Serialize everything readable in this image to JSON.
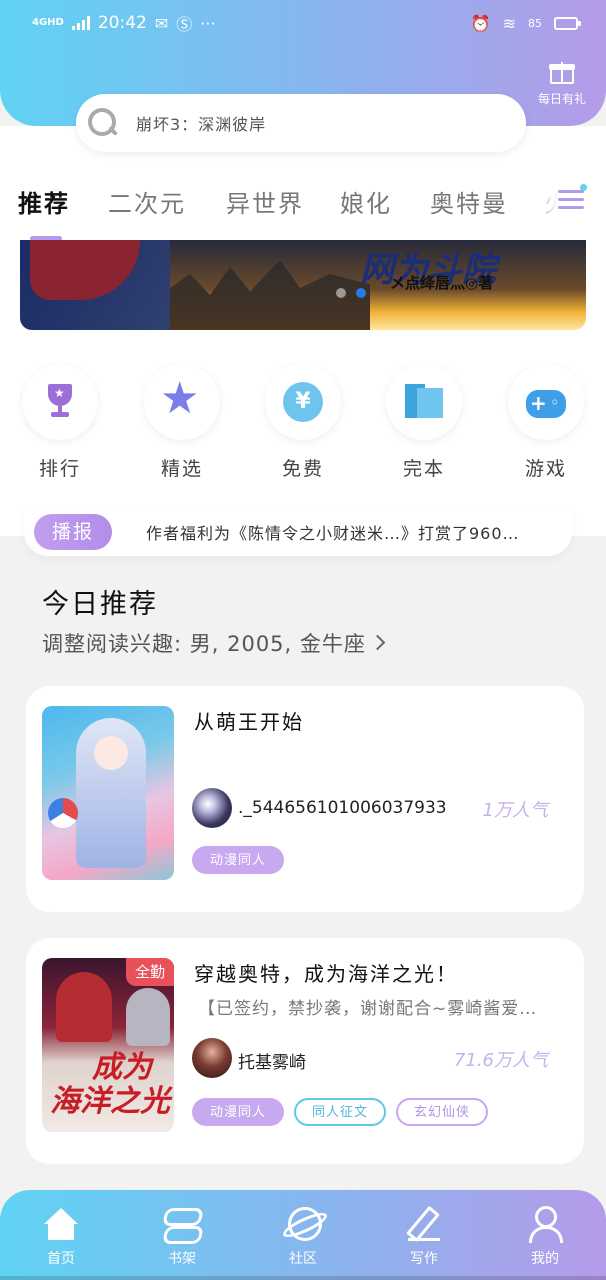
{
  "status_bar": {
    "network": "4GHD",
    "time": "20:42",
    "icons": [
      "wechat-icon",
      "s-app-icon",
      "more-dots-icon",
      "alarm-icon",
      "wifi-icon",
      "battery-icon"
    ],
    "more": "···",
    "battery_label": "85"
  },
  "search": {
    "placeholder": "崩坏3：深渊彼岸"
  },
  "daily_gift": {
    "label": "每日有礼"
  },
  "tabs": [
    {
      "label": "推荐",
      "active": true
    },
    {
      "label": "二次元"
    },
    {
      "label": "异世界"
    },
    {
      "label": "娘化"
    },
    {
      "label": "奥特曼"
    },
    {
      "label": "火"
    }
  ],
  "banner": {
    "title": "网为斗院",
    "author": "メ点绛唇灬◎著"
  },
  "quick_nav": [
    {
      "label": "排行",
      "icon": "trophy-icon"
    },
    {
      "label": "精选",
      "icon": "star-icon"
    },
    {
      "label": "免费",
      "icon": "yen-icon"
    },
    {
      "label": "完本",
      "icon": "book-icon"
    },
    {
      "label": "游戏",
      "icon": "gamepad-icon"
    }
  ],
  "broadcast": {
    "tag": "播报",
    "text": "作者福利为《陈情令之小财迷米…》打赏了960…"
  },
  "today": {
    "title": "今日推荐",
    "subtitle": "调整阅读兴趣: 男, 2005, 金牛座"
  },
  "books": [
    {
      "title": "从萌王开始",
      "description": "",
      "author": "._544656101006037933",
      "popularity": "1万人气",
      "badge": "",
      "tags": [
        "动漫同人"
      ]
    },
    {
      "title": "穿越奥特，成为海洋之光！",
      "description": "【已签约，禁抄袭，谢谢配合~雾崎酱爱…",
      "author": "托基雾崎",
      "popularity": "71.6万人气",
      "badge": "全勤",
      "cover_text_1": "成为",
      "cover_text_2": "海洋之光",
      "tags": [
        "动漫同人",
        "同人征文",
        "玄幻仙侠"
      ]
    }
  ],
  "bottom_nav": [
    {
      "label": "首页",
      "icon": "home-icon"
    },
    {
      "label": "书架",
      "icon": "bookshelf-icon"
    },
    {
      "label": "社区",
      "icon": "planet-icon"
    },
    {
      "label": "写作",
      "icon": "pen-icon"
    },
    {
      "label": "我的",
      "icon": "user-icon"
    }
  ],
  "colors": {
    "gradient_start": "#5fd3f3",
    "gradient_end": "#b59be9",
    "accent_purple": "#b39cf0",
    "popularity": "#c6b2ec"
  }
}
